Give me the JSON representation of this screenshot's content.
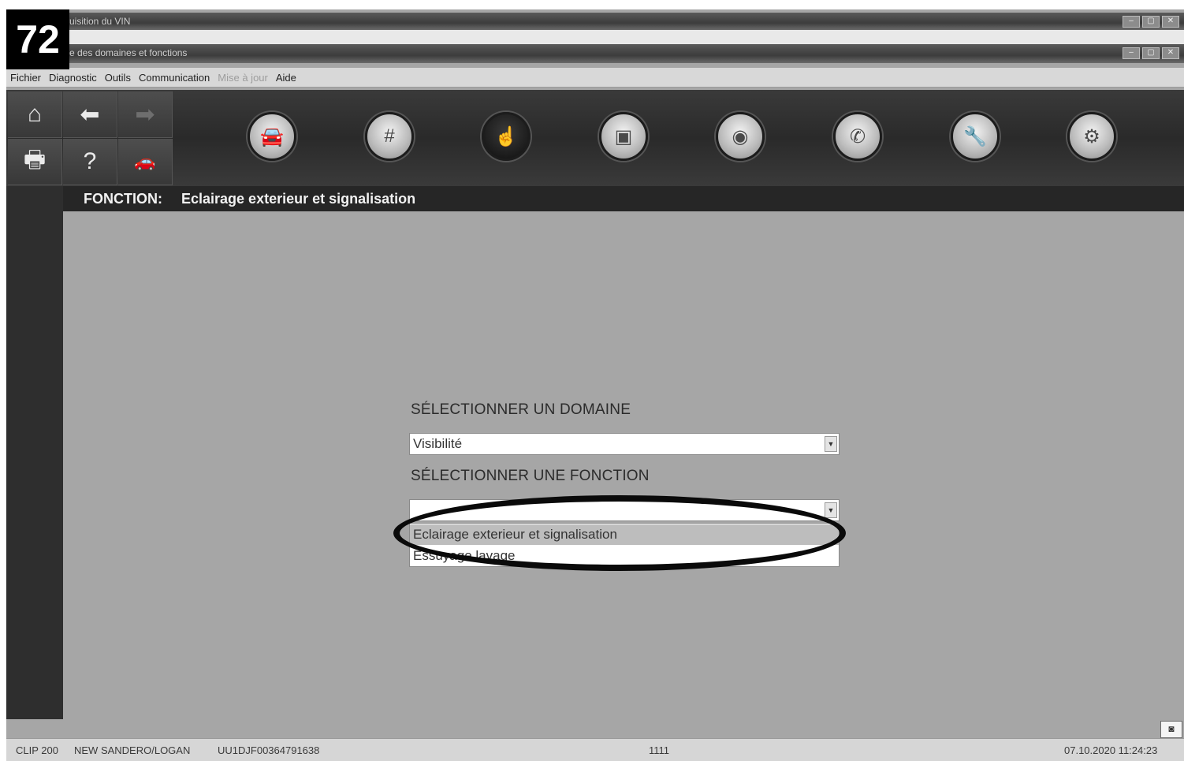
{
  "badge": "72",
  "window": {
    "title1": "uisition du VIN",
    "title2": "e des domaines et fonctions"
  },
  "menu": {
    "items": [
      "Fichier",
      "Diagnostic",
      "Outils",
      "Communication",
      "Mise à jour",
      "Aide"
    ]
  },
  "function_bar": {
    "label": "FONCTION:",
    "value": "Eclairage exterieur et signalisation"
  },
  "form": {
    "domain_heading": "SÉLECTIONNER UN DOMAINE",
    "domain_value": "Visibilité",
    "function_heading": "SÉLECTIONNER UNE FONCTION",
    "function_value": "",
    "options": [
      "Eclairage exterieur et signalisation",
      "Essuyage lavage"
    ]
  },
  "status": {
    "tool": "CLIP 200",
    "vehicle": "NEW SANDERO/LOGAN",
    "vin": "UU1DJF00364791638",
    "code": "1111",
    "datetime": "07.10.2020 11:24:23"
  }
}
